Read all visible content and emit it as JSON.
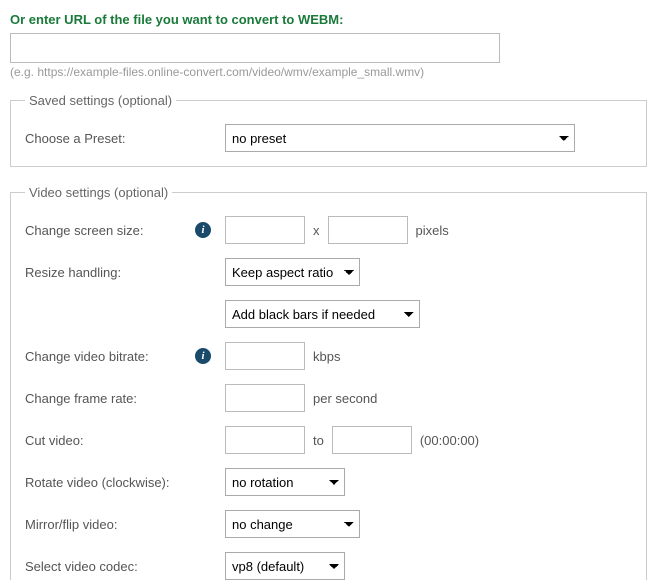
{
  "url_section": {
    "heading": "Or enter URL of the file you want to convert to WEBM:",
    "value": "",
    "hint": "(e.g. https://example-files.online-convert.com/video/wmv/example_small.wmv)"
  },
  "saved_settings": {
    "legend": "Saved settings (optional)",
    "preset_label": "Choose a Preset:",
    "preset_value": "no preset"
  },
  "video_settings": {
    "legend": "Video settings (optional)",
    "screen_size": {
      "label": "Change screen size:",
      "width": "",
      "height": "",
      "sep": "x",
      "unit": "pixels"
    },
    "resize_handling": {
      "label": "Resize handling:",
      "aspect_value": "Keep aspect ratio",
      "bars_value": "Add black bars if needed"
    },
    "bitrate": {
      "label": "Change video bitrate:",
      "value": "",
      "unit": "kbps"
    },
    "frame_rate": {
      "label": "Change frame rate:",
      "value": "",
      "unit": "per second"
    },
    "cut_video": {
      "label": "Cut video:",
      "from": "",
      "to_sep": "to",
      "to": "",
      "hint": "(00:00:00)"
    },
    "rotate": {
      "label": "Rotate video (clockwise):",
      "value": "no rotation"
    },
    "mirror": {
      "label": "Mirror/flip video:",
      "value": "no change"
    },
    "codec": {
      "label": "Select video codec:",
      "value": "vp8 (default)"
    }
  }
}
